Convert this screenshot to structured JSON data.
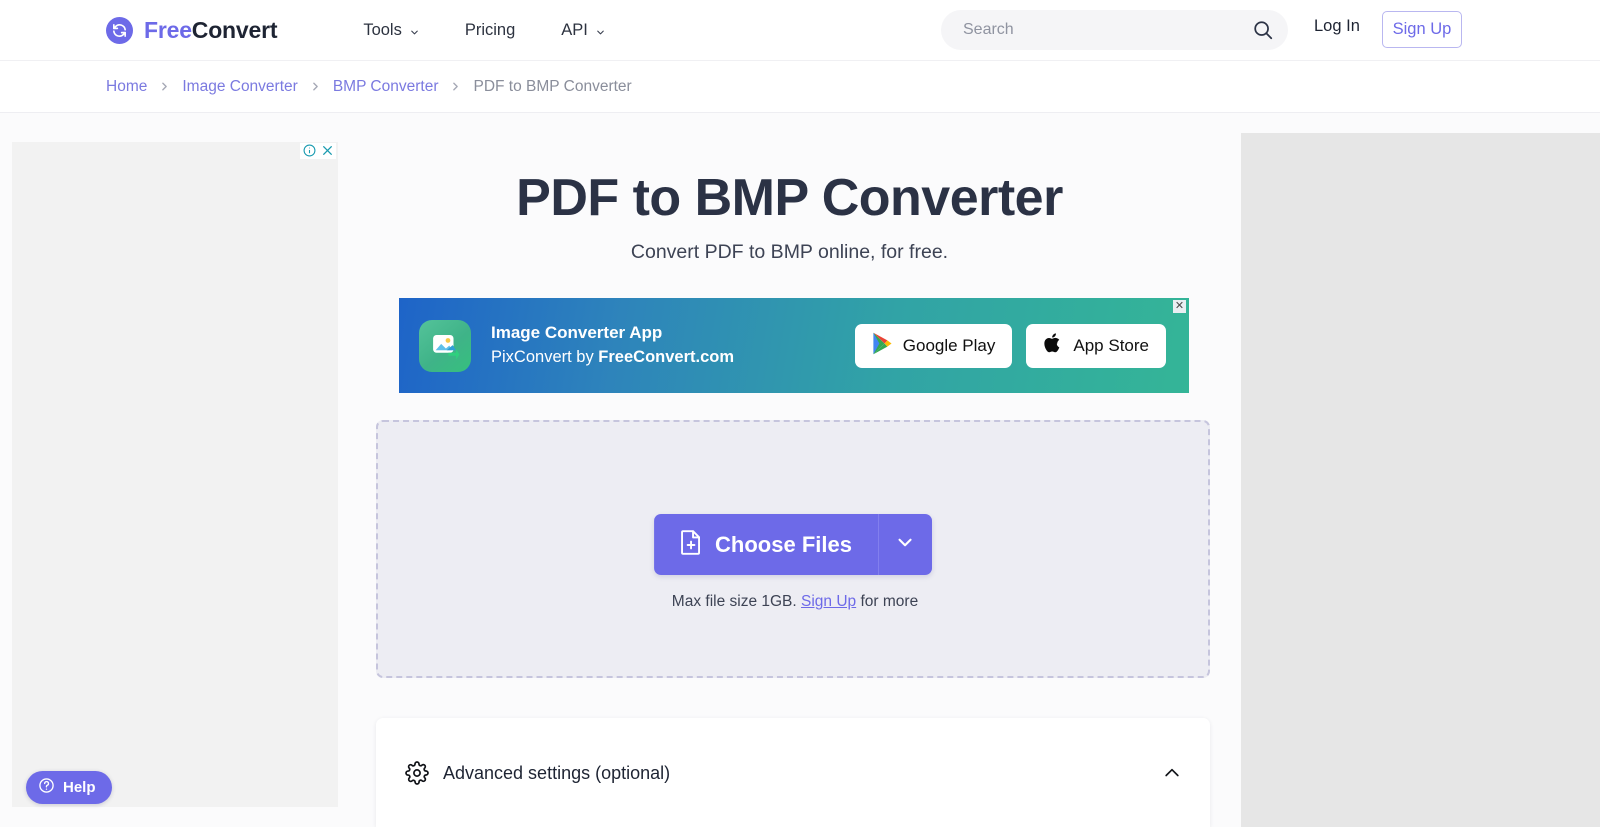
{
  "header": {
    "logo": {
      "part1": "Free",
      "part2": "Convert",
      "icon": "refresh-circle-icon"
    },
    "nav": [
      {
        "label": "Tools",
        "has_caret": true
      },
      {
        "label": "Pricing",
        "has_caret": false
      },
      {
        "label": "API",
        "has_caret": true
      }
    ],
    "search": {
      "placeholder": "Search",
      "value": "",
      "icon": "search-icon"
    },
    "login_label": "Log In",
    "signup_label": "Sign Up"
  },
  "breadcrumb": {
    "items": [
      {
        "label": "Home",
        "current": false
      },
      {
        "label": "Image Converter",
        "current": false
      },
      {
        "label": "BMP Converter",
        "current": false
      },
      {
        "label": "PDF to BMP Converter",
        "current": true
      }
    ],
    "separator": "›"
  },
  "ads": {
    "left": {
      "info_icon": "ad-info-icon",
      "close_icon": "ad-close-icon"
    },
    "right": {}
  },
  "main": {
    "title": "PDF to BMP Converter",
    "subtitle": "Convert PDF to BMP online, for free.",
    "banner": {
      "app_title": "Image Converter App",
      "app_sub_prefix": "PixConvert by ",
      "app_sub_brand": "FreeConvert.com",
      "icon": "photo-convert-app-icon",
      "close_label": "✕",
      "stores": [
        {
          "label": "Google Play",
          "icon": "google-play-icon"
        },
        {
          "label": "App Store",
          "icon": "apple-icon"
        }
      ]
    },
    "dropzone": {
      "choose_label": "Choose Files",
      "choose_icon": "file-plus-icon",
      "caret_icon": "chevron-down-icon",
      "maxsize_prefix": "Max file size 1GB. ",
      "maxsize_link": "Sign Up",
      "maxsize_suffix": " for more"
    },
    "advanced": {
      "label": "Advanced settings (optional)",
      "icon": "gear-icon",
      "chevron": "chevron-up-icon"
    }
  },
  "help": {
    "label": "Help",
    "icon": "question-circle-icon"
  },
  "colors": {
    "accent": "#6d6ae8",
    "text_dark": "#2b3245",
    "link": "#7b7ae0",
    "banner_start": "#1e64c8",
    "banner_end": "#34b597"
  }
}
